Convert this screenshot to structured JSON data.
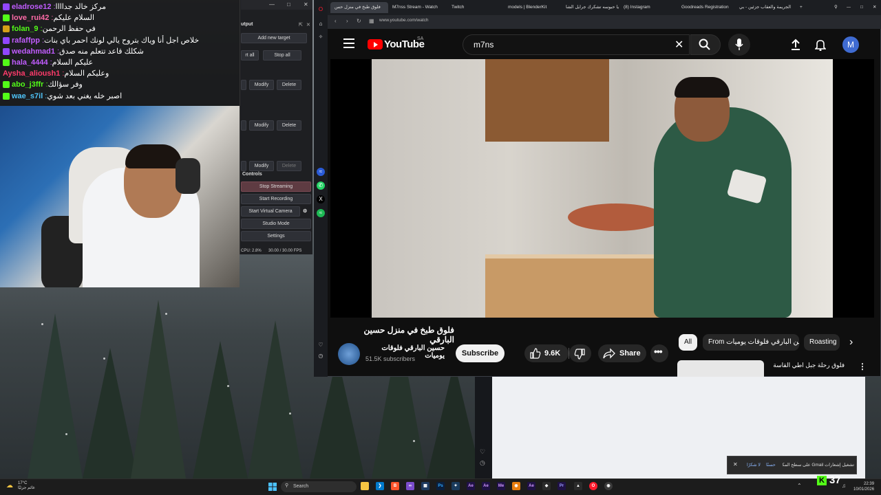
{
  "chat": {
    "messages": [
      {
        "user": "eladrose12",
        "user_color": "#c15cff",
        "badge_color": "#9146ff",
        "text": "مركز خالد جداااا"
      },
      {
        "user": "love_rui42",
        "user_color": "#ff6ba8",
        "badge_color": "#53fc18",
        "text": "السلام عليكم"
      },
      {
        "user": "folan_9",
        "user_color": "#53fc18",
        "badge_color": "#d4a017",
        "text": "في حفظ الرحمن"
      },
      {
        "user": "rafaffpp",
        "user_color": "#c15cff",
        "badge_color": "#9146ff",
        "text": "خلاص اجل أنا وياك بتروح يالي لونك احمر باي بنات"
      },
      {
        "user": "wedahmad1",
        "user_color": "#c15cff",
        "badge_color": "#9146ff",
        "text": "شكلك قاعد تتعلم منه صدق"
      },
      {
        "user": "hala_4444",
        "user_color": "#c15cff",
        "badge_color": "#53fc18",
        "text": "عليكم السلام"
      },
      {
        "user": "Aysha_alioush1",
        "user_color": "#ff3b6b",
        "badge_color": "",
        "text": "وعليكم السلام"
      },
      {
        "user": "abo_j3ffr",
        "user_color": "#53fc18",
        "badge_color": "#53fc18",
        "text": "وفر سؤالك"
      },
      {
        "user": "wae_s7il",
        "user_color": "#4fc3f7",
        "badge_color": "#53fc18",
        "text": "اصبر خله يغني بعد شوي"
      }
    ]
  },
  "obs": {
    "title": "utput",
    "add_target": "Add new target",
    "start_all": "rt all",
    "stop_all": "Stop all",
    "modify": "Modify",
    "delete": "Delete",
    "controls_label": "Controls",
    "stop_streaming": "Stop Streaming",
    "start_recording": "Start Recording",
    "start_virtual_camera": "Start Virtual Camera",
    "studio_mode": "Studio Mode",
    "settings": "Settings",
    "cpu": "CPU: 2.8%",
    "fps": "30.00 / 30.00 FPS"
  },
  "browser": {
    "tabs": [
      {
        "label": "فلوق طبخ في منزل حس",
        "active": true
      },
      {
        "label": "M7nss Stream - Watch",
        "active": false
      },
      {
        "label": "Twitch",
        "active": false
      },
      {
        "label": "models | BlenderKit",
        "active": false
      },
      {
        "label": "يا حبوسه تشكرك جرايل الشا",
        "active": false
      },
      {
        "label": "(8) Instagram",
        "active": false
      },
      {
        "label": "Goodreads Registration",
        "active": false
      },
      {
        "label": "الجريمة والعقاب جزئين - بي",
        "active": false
      }
    ],
    "url": "www.youtube.com/watch"
  },
  "youtube": {
    "logo": "YouTube",
    "country": "SA",
    "search_value": "m7ns",
    "avatar_letter": "M",
    "video_title": "فلوق طبخ في منزل حسين البارقي",
    "channel_name": "حسين البارقي فلوقات يوميات",
    "subscribers": "51.5K subscribers",
    "subscribe": "Subscribe",
    "likes": "9.6K",
    "share": "Share",
    "chips": [
      "All",
      "From حسين البارقي فلوقات يوميات",
      "Roasting"
    ],
    "rec_title": "فلوق رحلة جبل اطي القاسة"
  },
  "toast": {
    "text": "تشغيل إشعارات Gmail على سطح المكتب",
    "action1": "حسنًا",
    "action2": "لا شكرًا"
  },
  "taskbar": {
    "weather_temp": "17°C",
    "weather_desc": "غائم جزئيًا",
    "search": "Search",
    "viewer_count": "37",
    "time": "22:39",
    "date": "10/01/2026"
  }
}
